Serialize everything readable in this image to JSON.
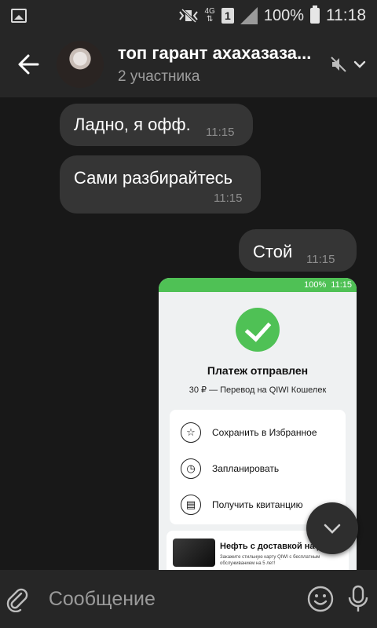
{
  "status_bar": {
    "network": "4G",
    "sim": "1",
    "battery": "100%",
    "time": "11:18"
  },
  "header": {
    "title": "топ гарант ахахазаза...",
    "subtitle": "2 участника",
    "icons": [
      "back-arrow-icon",
      "mute-icon",
      "chevron-down-icon"
    ]
  },
  "messages": [
    {
      "text": "Ладно, я офф.",
      "time": "11:15",
      "direction": "incoming"
    },
    {
      "text": "Сами разбирайтесь",
      "time": "11:15",
      "direction": "incoming"
    },
    {
      "text": "Стой",
      "time": "11:15",
      "direction": "outgoing"
    }
  ],
  "attachment": {
    "status_battery": "100%",
    "status_time": "11:15",
    "title": "Платеж отправлен",
    "subtitle": "30 ₽ — Перевод на QIWI Кошелек",
    "actions": [
      {
        "label": "Сохранить в Избранное",
        "icon": "star-icon"
      },
      {
        "label": "Запланировать",
        "icon": "clock-icon"
      },
      {
        "label": "Получить квитанцию",
        "icon": "receipt-icon"
      }
    ],
    "ad_title": "Нефть с доставкой на д...",
    "ad_text": "Закажите стильную карту QIWI с бесплатным обслуживанием на 5 лет!",
    "accent": "#4fc155"
  },
  "input": {
    "placeholder": "Сообщение",
    "icons": [
      "paperclip-icon",
      "emoji-icon",
      "microphone-icon"
    ]
  }
}
